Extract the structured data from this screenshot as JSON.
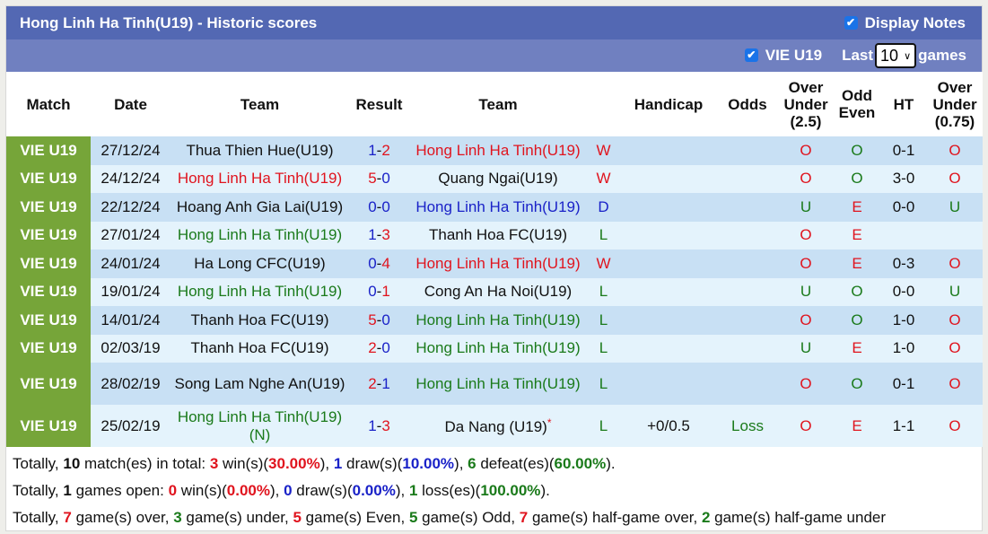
{
  "header": {
    "title": "Hong Linh Ha Tinh(U19) - Historic scores",
    "display_notes_label": "Display Notes",
    "display_notes_checked": true,
    "league_filter_label": "VIE U19",
    "league_filter_checked": true,
    "last_label": "Last",
    "last_value": "10",
    "games_label": "games"
  },
  "columns": {
    "match": "Match",
    "date": "Date",
    "team_home": "Team",
    "result": "Result",
    "team_away": "Team",
    "handicap": "Handicap",
    "odds": "Odds",
    "ou_1": "Over",
    "ou_2": "Under",
    "ou_3": "(2.5)",
    "oe_1": "Odd",
    "oe_2": "Even",
    "ht": "HT",
    "ouh_1": "Over",
    "ouh_2": "Under",
    "ouh_3": "(0.75)"
  },
  "colors": {
    "title_bar": "#5368b3",
    "sub_bar": "#7080c0",
    "league_cell": "#76a539",
    "row_odd": "#c8e0f4",
    "row_even": "#e4f3fc",
    "red": "#e0141e",
    "blue": "#1a22c8",
    "green": "#1a7a1a"
  },
  "rows": [
    {
      "league": "VIE U19",
      "date": "27/12/24",
      "home": "Thua Thien Hue(U19)",
      "home_color": "black",
      "hs": "1",
      "hs_color": "blue",
      "as": "2",
      "as_color": "red",
      "away": "Hong Linh Ha Tinh(U19)",
      "away_color": "red",
      "wdl": "W",
      "wdl_color": "red",
      "handicap": "",
      "odds": "",
      "odds_color": "green",
      "ou": "O",
      "ou_color": "red",
      "oe": "O",
      "oe_color": "green",
      "ht": "0-1",
      "ouh": "O",
      "ouh_color": "red"
    },
    {
      "league": "VIE U19",
      "date": "24/12/24",
      "home": "Hong Linh Ha Tinh(U19)",
      "home_color": "red",
      "hs": "5",
      "hs_color": "red",
      "as": "0",
      "as_color": "blue",
      "away": "Quang Ngai(U19)",
      "away_color": "black",
      "wdl": "W",
      "wdl_color": "red",
      "handicap": "",
      "odds": "",
      "odds_color": "green",
      "ou": "O",
      "ou_color": "red",
      "oe": "O",
      "oe_color": "green",
      "ht": "3-0",
      "ouh": "O",
      "ouh_color": "red"
    },
    {
      "league": "VIE U19",
      "date": "22/12/24",
      "home": "Hoang Anh Gia Lai(U19)",
      "home_color": "black",
      "hs": "0",
      "hs_color": "blue",
      "as": "0",
      "as_color": "blue",
      "away": "Hong Linh Ha Tinh(U19)",
      "away_color": "blue",
      "wdl": "D",
      "wdl_color": "blue",
      "handicap": "",
      "odds": "",
      "odds_color": "green",
      "ou": "U",
      "ou_color": "green",
      "oe": "E",
      "oe_color": "red",
      "ht": "0-0",
      "ouh": "U",
      "ouh_color": "green"
    },
    {
      "league": "VIE U19",
      "date": "27/01/24",
      "home": "Hong Linh Ha Tinh(U19)",
      "home_color": "green",
      "hs": "1",
      "hs_color": "blue",
      "as": "3",
      "as_color": "red",
      "away": "Thanh Hoa FC(U19)",
      "away_color": "black",
      "wdl": "L",
      "wdl_color": "green",
      "handicap": "",
      "odds": "",
      "odds_color": "green",
      "ou": "O",
      "ou_color": "red",
      "oe": "E",
      "oe_color": "red",
      "ht": "",
      "ouh": "",
      "ouh_color": "red"
    },
    {
      "league": "VIE U19",
      "date": "24/01/24",
      "home": "Ha Long CFC(U19)",
      "home_color": "black",
      "hs": "0",
      "hs_color": "blue",
      "as": "4",
      "as_color": "red",
      "away": "Hong Linh Ha Tinh(U19)",
      "away_color": "red",
      "wdl": "W",
      "wdl_color": "red",
      "handicap": "",
      "odds": "",
      "odds_color": "green",
      "ou": "O",
      "ou_color": "red",
      "oe": "E",
      "oe_color": "red",
      "ht": "0-3",
      "ouh": "O",
      "ouh_color": "red"
    },
    {
      "league": "VIE U19",
      "date": "19/01/24",
      "home": "Hong Linh Ha Tinh(U19)",
      "home_color": "green",
      "hs": "0",
      "hs_color": "blue",
      "as": "1",
      "as_color": "red",
      "away": "Cong An Ha Noi(U19)",
      "away_color": "black",
      "wdl": "L",
      "wdl_color": "green",
      "handicap": "",
      "odds": "",
      "odds_color": "green",
      "ou": "U",
      "ou_color": "green",
      "oe": "O",
      "oe_color": "green",
      "ht": "0-0",
      "ouh": "U",
      "ouh_color": "green"
    },
    {
      "league": "VIE U19",
      "date": "14/01/24",
      "home": "Thanh Hoa FC(U19)",
      "home_color": "black",
      "hs": "5",
      "hs_color": "red",
      "as": "0",
      "as_color": "blue",
      "away": "Hong Linh Ha Tinh(U19)",
      "away_color": "green",
      "wdl": "L",
      "wdl_color": "green",
      "handicap": "",
      "odds": "",
      "odds_color": "green",
      "ou": "O",
      "ou_color": "red",
      "oe": "O",
      "oe_color": "green",
      "ht": "1-0",
      "ouh": "O",
      "ouh_color": "red"
    },
    {
      "league": "VIE U19",
      "date": "02/03/19",
      "home": "Thanh Hoa FC(U19)",
      "home_color": "black",
      "hs": "2",
      "hs_color": "red",
      "as": "0",
      "as_color": "blue",
      "away": "Hong Linh Ha Tinh(U19)",
      "away_color": "green",
      "wdl": "L",
      "wdl_color": "green",
      "handicap": "",
      "odds": "",
      "odds_color": "green",
      "ou": "U",
      "ou_color": "green",
      "oe": "E",
      "oe_color": "red",
      "ht": "1-0",
      "ouh": "O",
      "ouh_color": "red"
    },
    {
      "league": "VIE U19",
      "date": "28/02/19",
      "home": "Song Lam Nghe An(U19)",
      "home_color": "black",
      "hs": "2",
      "hs_color": "red",
      "as": "1",
      "as_color": "blue",
      "away": "Hong Linh Ha Tinh(U19)",
      "away_color": "green",
      "wdl": "L",
      "wdl_color": "green",
      "handicap": "",
      "odds": "",
      "odds_color": "green",
      "ou": "O",
      "ou_color": "red",
      "oe": "O",
      "oe_color": "green",
      "ht": "0-1",
      "ouh": "O",
      "ouh_color": "red",
      "tall": true
    },
    {
      "league": "VIE U19",
      "date": "25/02/19",
      "home": "Hong Linh Ha Tinh(U19) (N)",
      "home_color": "green",
      "hs": "1",
      "hs_color": "blue",
      "as": "3",
      "as_color": "red",
      "away": "Da Nang (U19)",
      "away_color": "black",
      "away_star": "*",
      "wdl": "L",
      "wdl_color": "green",
      "handicap": "+0/0.5",
      "odds": "Loss",
      "odds_color": "green",
      "ou": "O",
      "ou_color": "red",
      "oe": "E",
      "oe_color": "red",
      "ht": "1-1",
      "ouh": "O",
      "ouh_color": "red",
      "tall": true
    }
  ],
  "summary": {
    "line1": {
      "prefix": "Totally, ",
      "total": "10",
      "t1": " match(es) in total: ",
      "wins": "3",
      "t2": " win(s)(",
      "win_pct": "30.00%",
      "t3": "), ",
      "draws": "1",
      "t4": " draw(s)(",
      "draw_pct": "10.00%",
      "t5": "), ",
      "defeats": "6",
      "t6": " defeat(es)(",
      "defeat_pct": "60.00%",
      "t7": ")."
    },
    "line2": {
      "prefix": "Totally, ",
      "open": "1",
      "t1": " games open: ",
      "wins": "0",
      "t2": " win(s)(",
      "win_pct": "0.00%",
      "t3": "), ",
      "draws": "0",
      "t4": " draw(s)(",
      "draw_pct": "0.00%",
      "t5": "), ",
      "losses": "1",
      "t6": " loss(es)(",
      "loss_pct": "100.00%",
      "t7": ")."
    },
    "line3": {
      "prefix": "Totally, ",
      "over": "7",
      "t1": " game(s) over, ",
      "under": "3",
      "t2": " game(s) under, ",
      "even": "5",
      "t3": " game(s) Even, ",
      "odd": "5",
      "t4": " game(s) Odd, ",
      "hg_over": "7",
      "t5": " game(s) half-game over, ",
      "hg_under": "2",
      "t6": " game(s) half-game under"
    }
  }
}
